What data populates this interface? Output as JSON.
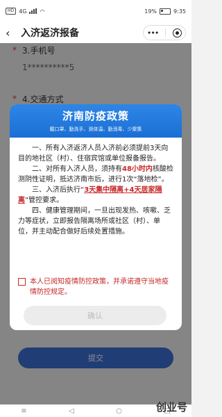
{
  "status_bar": {
    "left": "HD",
    "net": "4G",
    "battery": "19%",
    "time": "9:35"
  },
  "nav": {
    "title": "入济返济报备"
  },
  "form": {
    "phone_label": "3.手机号",
    "phone_value": "1**********5",
    "transport_label": "4.交通方式",
    "submit_label": "提交"
  },
  "modal": {
    "title": "济南防疫政策",
    "subtitle": "戴口罩、勤洗手、测体温、勤消毒、少聚集",
    "para1": "一、所有入济返济人员入济前必须提前3天向目的地社区（村）、住宿宾馆或单位报备报告。",
    "para2_a": "二、对所有入济人员，须持有",
    "para2_b": "48小时内",
    "para2_c": "核酸检测阴性证明，抵达济南市后，进行1次“落地检”。",
    "para3_a": "三、入济后执行“",
    "para3_b": "3天集中隔离+4天居家隔离",
    "para3_c": "”管控要求。",
    "para4": "四、健康管理期间，一旦出现发热、咳嗽、乏力等症状，立即报告隔离场所或社区（村）、单位，并主动配合做好后续处置措施。",
    "consent": "本人已阅知疫情防控政策，并承诺遵守当地疫情防控规定。",
    "confirm_label": "确认"
  },
  "watermark": "创业号"
}
